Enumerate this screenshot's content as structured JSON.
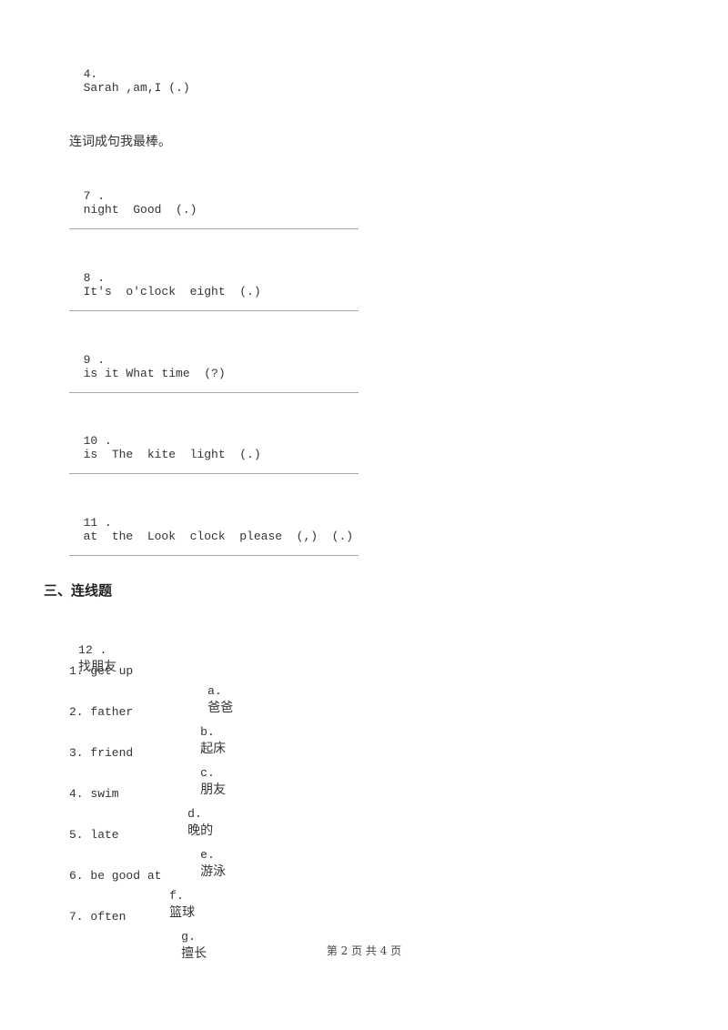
{
  "previous_items": [
    {
      "number": "4.",
      "text": "Sarah ,am,I (.)"
    }
  ],
  "section_two_instruction": "连词成句我最棒。",
  "sentence_items": [
    {
      "number": "7 .",
      "text": "night  Good  (.)"
    },
    {
      "number": "8 .",
      "text": "It's  o'clock  eight  (.)"
    },
    {
      "number": "9 .",
      "text": "is it What time  (?)"
    },
    {
      "number": "10 .",
      "text": "is  The  kite  light  (.)"
    },
    {
      "number": "11 .",
      "text": "at  the  Look  clock  please  (,)  (.)"
    }
  ],
  "section_three": {
    "title": "三、连线题",
    "question": {
      "number": "12 .",
      "text": "找朋友"
    },
    "match_pairs": [
      {
        "left": "1. get up",
        "right_letter": "a.",
        "right_text": "爸爸"
      },
      {
        "left": "2. father",
        "right_letter": "b.",
        "right_text": "起床"
      },
      {
        "left": "3. friend",
        "right_letter": "c.",
        "right_text": "朋友"
      },
      {
        "left": "4. swim",
        "right_letter": "d.",
        "right_text": "晚的"
      },
      {
        "left": "5. late",
        "right_letter": "e.",
        "right_text": "游泳"
      },
      {
        "left": "6. be good at",
        "right_letter": "f.",
        "right_text": "篮球"
      },
      {
        "left": "7. often",
        "right_letter": "g.",
        "right_text": "擅长"
      }
    ]
  },
  "footer": {
    "page_label": "第 2 页 共 4 页"
  }
}
